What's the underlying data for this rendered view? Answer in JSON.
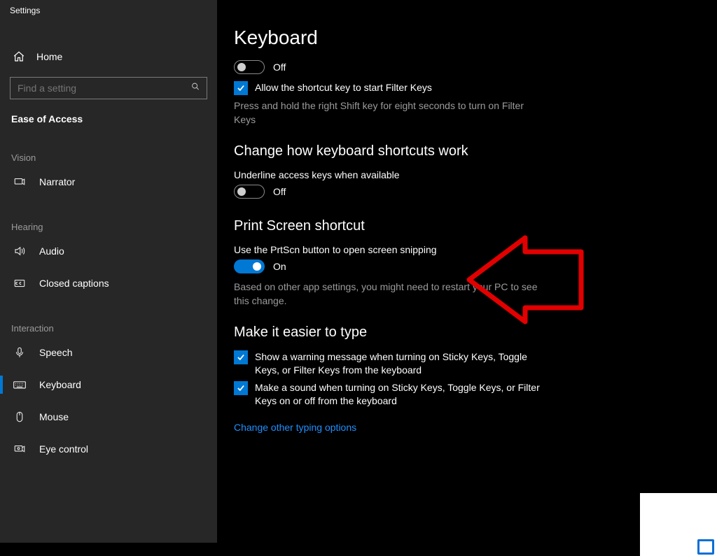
{
  "window": {
    "title": "Settings"
  },
  "sidebar": {
    "home": "Home",
    "search_placeholder": "Find a setting",
    "section": "Ease of Access",
    "groups": [
      {
        "header": "Vision",
        "items": [
          {
            "icon": "narrator-icon",
            "label": "Narrator"
          }
        ]
      },
      {
        "header": "Hearing",
        "items": [
          {
            "icon": "audio-icon",
            "label": "Audio"
          },
          {
            "icon": "captions-icon",
            "label": "Closed captions"
          }
        ]
      },
      {
        "header": "Interaction",
        "items": [
          {
            "icon": "speech-icon",
            "label": "Speech"
          },
          {
            "icon": "keyboard-icon",
            "label": "Keyboard",
            "selected": true
          },
          {
            "icon": "mouse-icon",
            "label": "Mouse"
          },
          {
            "icon": "eye-icon",
            "label": "Eye control"
          }
        ]
      }
    ]
  },
  "page": {
    "title": "Keyboard",
    "filter_toggle": {
      "state": "Off"
    },
    "filter_check": "Allow the shortcut key to start Filter Keys",
    "filter_hint": "Press and hold the right Shift key for eight seconds to turn on Filter Keys",
    "shortcuts": {
      "title": "Change how keyboard shortcuts work",
      "underline_label": "Underline access keys when available",
      "underline_state": "Off"
    },
    "prtscn": {
      "title": "Print Screen shortcut",
      "label": "Use the PrtScn button to open screen snipping",
      "state": "On",
      "hint": "Based on other app settings, you might need to restart your PC to see this change."
    },
    "easier": {
      "title": "Make it easier to type",
      "check1": "Show a warning message when turning on Sticky Keys, Toggle Keys, or Filter Keys from the keyboard",
      "check2": "Make a sound when turning on Sticky Keys, Toggle Keys, or Filter Keys on or off from the keyboard",
      "link": "Change other typing options"
    }
  }
}
